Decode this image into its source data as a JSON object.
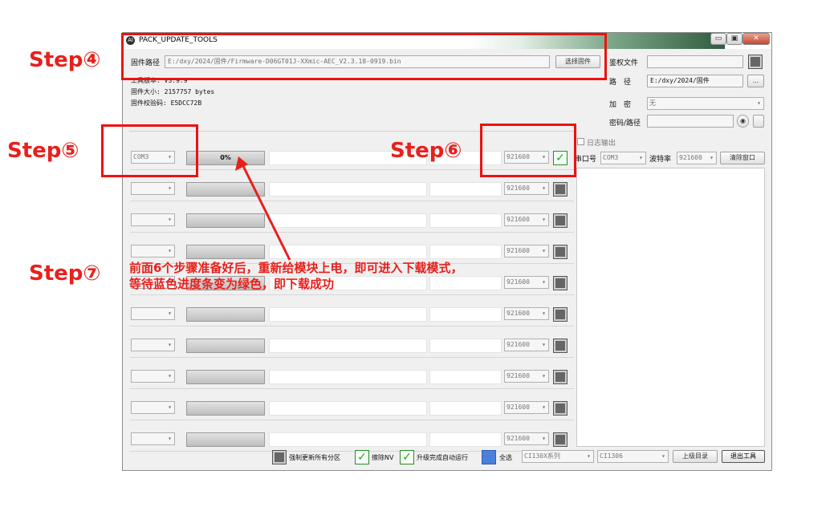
{
  "window": {
    "title": "PACK_UPDATE_TOOLS",
    "icon": "app-logo-icon",
    "controls": [
      "minimize",
      "maximize",
      "close"
    ]
  },
  "firmware": {
    "path_label": "固件路径",
    "path_value": "E:/dxy/2024/固件/Firmware-D06GT01J-XXmic-AEC_V2.3.18-0919.bin",
    "select_button": "选择固件"
  },
  "info": {
    "tool_version": "工具版本: V3.9.9",
    "size": "固件大小: 2157757 bytes",
    "checksum": "固件校验码: E5DCC72B"
  },
  "right_panel": {
    "auth_label": "鉴权文件",
    "auth_value": "",
    "path_label": "路　径",
    "path_value": "E:/dxy/2024/固件",
    "browse_button": "...",
    "encrypt_label": "加　密",
    "encrypt_value": "无",
    "key_label": "密码/路径",
    "key_value": "",
    "log_output_label": "日志输出",
    "port_label": "串口号",
    "port_value": "COM3",
    "baud_label": "波特率",
    "baud_value": "921600",
    "clear_button": "清除窗口"
  },
  "rows": [
    {
      "port": "COM3",
      "progress": "0%",
      "baud": "921600",
      "checked": true
    },
    {
      "port": "",
      "progress": "",
      "baud": "921600",
      "checked": false
    },
    {
      "port": "",
      "progress": "",
      "baud": "921600",
      "checked": false
    },
    {
      "port": "",
      "progress": "",
      "baud": "921600",
      "checked": false
    },
    {
      "port": "",
      "progress": "",
      "baud": "921600",
      "checked": false
    },
    {
      "port": "",
      "progress": "",
      "baud": "921600",
      "checked": false
    },
    {
      "port": "",
      "progress": "",
      "baud": "921600",
      "checked": false
    },
    {
      "port": "",
      "progress": "",
      "baud": "921600",
      "checked": false
    },
    {
      "port": "",
      "progress": "",
      "baud": "921600",
      "checked": false
    },
    {
      "port": "",
      "progress": "",
      "baud": "921600",
      "checked": false
    }
  ],
  "bottom": {
    "force_update": "强制更新所有分区",
    "erase_nv": "擦除NV",
    "auto_run": "升级完成自动运行",
    "select_all": "全选",
    "chip_series": "CI130X系列",
    "chip_model": "CI1306",
    "parent_dir_button": "上级目录",
    "exit_button": "退出工具"
  },
  "annotations": {
    "step4": "Step④",
    "step5": "Step⑤",
    "step6": "Step⑥",
    "step7": "Step⑦",
    "note_line1": "前面6个步骤准备好后，重新给模块上电，即可进入下载模式，",
    "note_line2": "等待蓝色进度条变为绿色，即下载成功"
  },
  "colors": {
    "annotation_red": "#e8201c",
    "check_green": "#22aa22",
    "select_all_blue": "#4a7fdc"
  }
}
